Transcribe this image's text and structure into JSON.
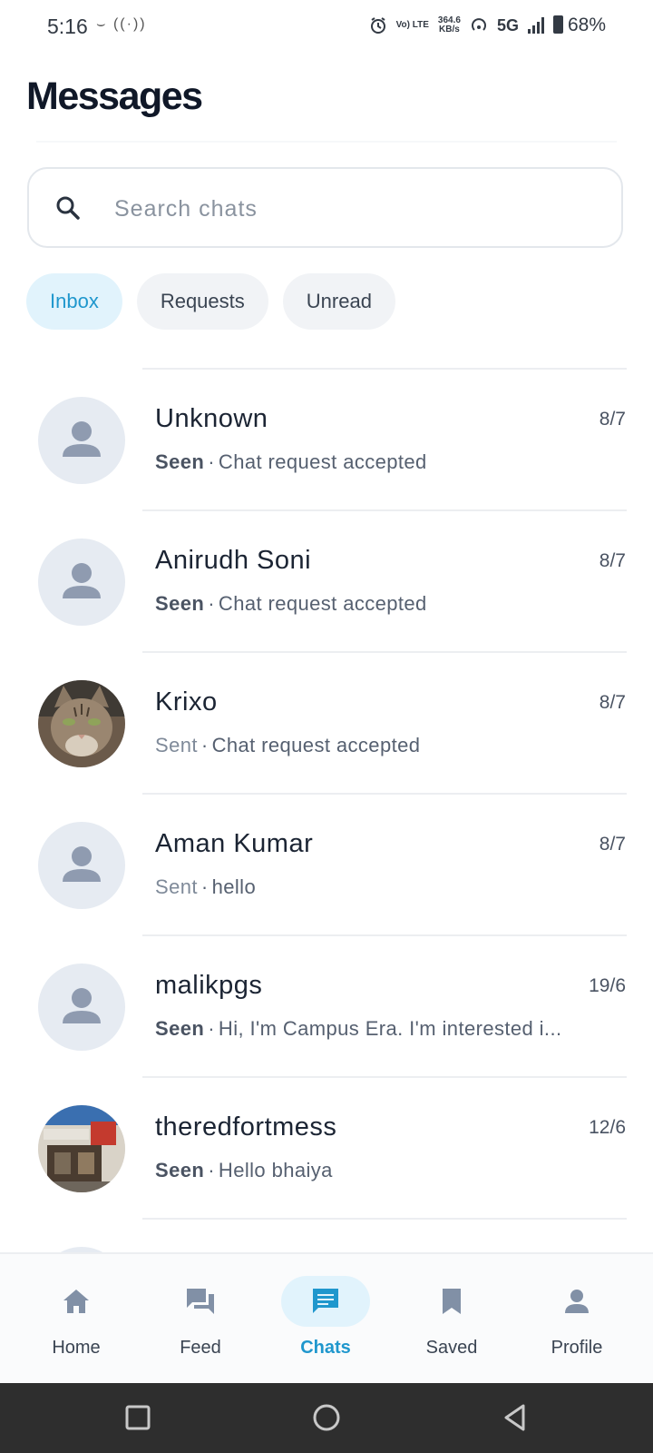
{
  "status_bar": {
    "time": "5:16",
    "left_icons": "⌣ ((·))",
    "volte": "Vo) LTE",
    "speed_value": "364.6",
    "speed_unit": "KB/s",
    "network": "5G",
    "battery": "68%"
  },
  "header": {
    "title": "Messages"
  },
  "search": {
    "placeholder": "Search chats",
    "value": ""
  },
  "tabs": [
    {
      "label": "Inbox",
      "active": true
    },
    {
      "label": "Requests",
      "active": false
    },
    {
      "label": "Unread",
      "active": false
    }
  ],
  "chats": [
    {
      "name": "Unknown",
      "date": "8/7",
      "status": "Seen",
      "separator": "·",
      "preview": "Chat request accepted",
      "avatar": "person-placeholder-icon"
    },
    {
      "name": "Anirudh Soni",
      "date": "8/7",
      "status": "Seen",
      "separator": "·",
      "preview": "Chat request accepted",
      "avatar": "person-placeholder-icon"
    },
    {
      "name": "Krixo",
      "date": "8/7",
      "status": "Sent",
      "separator": "·",
      "preview": "Chat request accepted",
      "avatar": "cat-photo"
    },
    {
      "name": "Aman Kumar",
      "date": "8/7",
      "status": "Sent",
      "separator": "·",
      "preview": "hello",
      "avatar": "person-placeholder-icon"
    },
    {
      "name": "malikpgs",
      "date": "19/6",
      "status": "Seen",
      "separator": "·",
      "preview": "Hi, I'm Campus Era. I'm interested i...",
      "avatar": "person-placeholder-icon"
    },
    {
      "name": "theredfortmess",
      "date": "12/6",
      "status": "Seen",
      "separator": "·",
      "preview": "Hello bhaiya",
      "avatar": "storefront-photo"
    }
  ],
  "bottom_nav": [
    {
      "label": "Home",
      "icon": "home-icon",
      "active": false
    },
    {
      "label": "Feed",
      "icon": "chat-bubbles-icon",
      "active": false
    },
    {
      "label": "Chats",
      "icon": "chat-bubble-icon",
      "active": true
    },
    {
      "label": "Saved",
      "icon": "bookmark-icon",
      "active": false
    },
    {
      "label": "Profile",
      "icon": "person-icon",
      "active": false
    }
  ],
  "colors": {
    "accent": "#1f97cd",
    "accent_bg": "#e1f3fc",
    "title": "#101828",
    "avatar_bg": "#e6ebf2",
    "avatar_icon": "#8f9bb0",
    "system_nav_bg": "#2e2e2e"
  }
}
